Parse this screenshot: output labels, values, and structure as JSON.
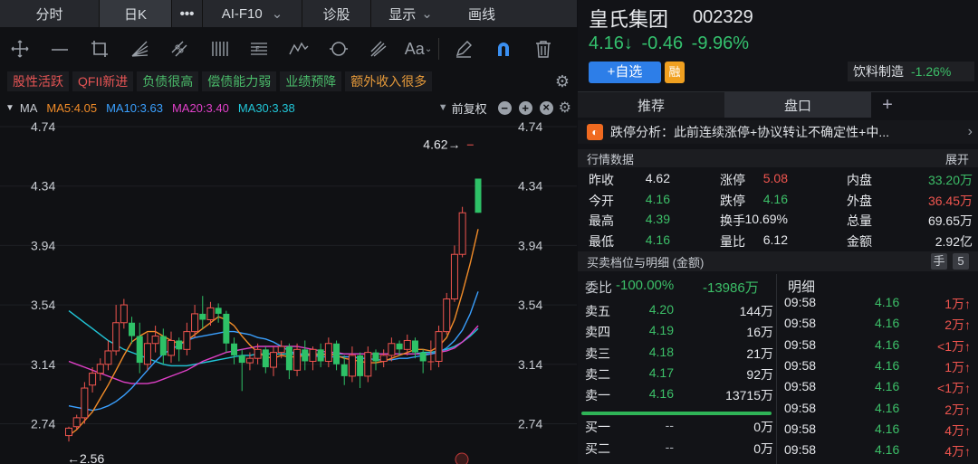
{
  "tabs": {
    "fenshi": "分时",
    "rik": "日K",
    "more": "•••",
    "aif10": "AI-F10",
    "zhengu": "诊股",
    "display": "显示",
    "draw": "画线"
  },
  "tags": [
    {
      "label": "股性活跃",
      "color": "red"
    },
    {
      "label": "QFII新进",
      "color": "red"
    },
    {
      "label": "负债很高",
      "color": "green"
    },
    {
      "label": "偿债能力弱",
      "color": "green"
    },
    {
      "label": "业绩预降",
      "color": "green"
    },
    {
      "label": "额外收入很多",
      "color": "orange"
    }
  ],
  "ma": {
    "label": "MA",
    "ma5": "MA5:4.05",
    "ma10": "MA10:3.63",
    "ma20": "MA20:3.40",
    "ma30": "MA30:3.38",
    "fq": "前复权",
    "colors": {
      "ma5": "#f28c28",
      "ma10": "#3aa0ff",
      "ma20": "#e040c8",
      "ma30": "#21c6d8"
    }
  },
  "chart_data": {
    "type": "candlestick",
    "ylim": [
      2.56,
      4.74
    ],
    "yticks": [
      "4.74",
      "4.34",
      "3.94",
      "3.54",
      "3.14",
      "2.74"
    ],
    "high_label": "4.62→",
    "low_label": "←2.56",
    "candles": [
      [
        2.66,
        2.71,
        2.62,
        2.72
      ],
      [
        2.72,
        2.78,
        2.7,
        2.8
      ],
      [
        2.78,
        2.98,
        2.74,
        3.02
      ],
      [
        3.0,
        3.08,
        2.95,
        3.12
      ],
      [
        3.08,
        3.14,
        3.03,
        3.18
      ],
      [
        3.14,
        3.23,
        3.1,
        3.3
      ],
      [
        3.23,
        3.42,
        3.2,
        3.54
      ],
      [
        3.42,
        3.54,
        3.38,
        3.58
      ],
      [
        3.42,
        3.33,
        3.28,
        3.46
      ],
      [
        3.33,
        3.15,
        3.08,
        3.42
      ],
      [
        3.14,
        3.28,
        3.1,
        3.35
      ],
      [
        3.28,
        3.33,
        3.22,
        3.4
      ],
      [
        3.33,
        3.2,
        3.14,
        3.38
      ],
      [
        3.2,
        3.3,
        3.15,
        3.36
      ],
      [
        3.3,
        3.24,
        3.16,
        3.32
      ],
      [
        3.24,
        3.36,
        3.2,
        3.42
      ],
      [
        3.36,
        3.48,
        3.32,
        3.54
      ],
      [
        3.48,
        3.44,
        3.38,
        3.6
      ],
      [
        3.44,
        3.52,
        3.4,
        3.56
      ],
      [
        3.52,
        3.48,
        3.42,
        3.55
      ],
      [
        3.48,
        3.28,
        3.22,
        3.5
      ],
      [
        3.28,
        3.2,
        3.14,
        3.32
      ],
      [
        3.2,
        3.15,
        2.96,
        3.24
      ],
      [
        3.15,
        3.18,
        3.1,
        3.22
      ],
      [
        3.18,
        3.24,
        3.14,
        3.28
      ],
      [
        3.24,
        3.12,
        3.08,
        3.26
      ],
      [
        3.12,
        3.22,
        3.06,
        3.26
      ],
      [
        3.22,
        3.26,
        3.18,
        3.3
      ],
      [
        3.26,
        3.1,
        3.04,
        3.28
      ],
      [
        3.1,
        3.24,
        3.06,
        3.28
      ],
      [
        3.24,
        3.16,
        3.1,
        3.3
      ],
      [
        3.16,
        3.24,
        3.1,
        3.26
      ],
      [
        3.24,
        3.16,
        3.12,
        3.28
      ],
      [
        3.16,
        3.28,
        3.12,
        3.32
      ],
      [
        3.28,
        3.14,
        3.1,
        3.3
      ],
      [
        3.14,
        3.06,
        3.0,
        3.2
      ],
      [
        3.06,
        3.2,
        3.02,
        3.26
      ],
      [
        3.2,
        3.06,
        2.98,
        3.22
      ],
      [
        3.06,
        3.22,
        3.02,
        3.26
      ],
      [
        3.22,
        3.16,
        3.1,
        3.24
      ],
      [
        3.16,
        3.2,
        3.12,
        3.24
      ],
      [
        3.2,
        3.28,
        3.16,
        3.32
      ],
      [
        3.28,
        3.24,
        3.2,
        3.3
      ],
      [
        3.24,
        3.3,
        3.2,
        3.34
      ],
      [
        3.3,
        3.22,
        3.18,
        3.32
      ],
      [
        3.22,
        3.16,
        3.08,
        3.24
      ],
      [
        3.16,
        3.16,
        3.1,
        3.3
      ],
      [
        3.16,
        3.36,
        3.12,
        3.4
      ],
      [
        3.36,
        3.58,
        3.34,
        3.62
      ],
      [
        3.58,
        3.88,
        3.56,
        3.94
      ],
      [
        3.88,
        4.16,
        3.86,
        4.2
      ],
      [
        4.62,
        4.62,
        4.62,
        4.62
      ],
      [
        4.39,
        4.16,
        4.16,
        4.39
      ]
    ],
    "ma5": [
      2.66,
      2.7,
      2.76,
      2.82,
      2.91,
      3.0,
      3.1,
      3.2,
      3.29,
      3.33,
      3.36,
      3.36,
      3.33,
      3.3,
      3.28,
      3.3,
      3.34,
      3.38,
      3.42,
      3.46,
      3.44,
      3.4,
      3.33,
      3.27,
      3.22,
      3.19,
      3.18,
      3.2,
      3.19,
      3.19,
      3.2,
      3.21,
      3.2,
      3.21,
      3.2,
      3.18,
      3.17,
      3.16,
      3.15,
      3.15,
      3.16,
      3.18,
      3.2,
      3.22,
      3.24,
      3.24,
      3.23,
      3.26,
      3.32,
      3.44,
      3.62,
      3.82,
      4.05
    ],
    "ma10": [
      2.86,
      2.85,
      2.84,
      2.83,
      2.84,
      2.86,
      2.89,
      2.93,
      2.98,
      3.04,
      3.1,
      3.16,
      3.21,
      3.24,
      3.27,
      3.3,
      3.32,
      3.33,
      3.34,
      3.35,
      3.36,
      3.36,
      3.35,
      3.34,
      3.32,
      3.31,
      3.29,
      3.26,
      3.23,
      3.21,
      3.2,
      3.2,
      3.19,
      3.19,
      3.19,
      3.19,
      3.19,
      3.18,
      3.18,
      3.17,
      3.17,
      3.17,
      3.18,
      3.18,
      3.19,
      3.2,
      3.21,
      3.22,
      3.25,
      3.3,
      3.37,
      3.48,
      3.63
    ],
    "ma20": [
      3.16,
      3.14,
      3.12,
      3.1,
      3.08,
      3.06,
      3.04,
      3.02,
      3.01,
      3.01,
      3.01,
      3.02,
      3.04,
      3.06,
      3.08,
      3.1,
      3.13,
      3.16,
      3.18,
      3.2,
      3.22,
      3.23,
      3.24,
      3.25,
      3.26,
      3.26,
      3.26,
      3.26,
      3.26,
      3.26,
      3.25,
      3.24,
      3.23,
      3.22,
      3.22,
      3.21,
      3.21,
      3.21,
      3.21,
      3.21,
      3.21,
      3.21,
      3.21,
      3.21,
      3.21,
      3.21,
      3.21,
      3.22,
      3.23,
      3.25,
      3.29,
      3.34,
      3.4
    ],
    "ma30": [
      3.5,
      3.46,
      3.42,
      3.38,
      3.34,
      3.3,
      3.27,
      3.24,
      3.22,
      3.2,
      3.18,
      3.16,
      3.14,
      3.13,
      3.13,
      3.13,
      3.14,
      3.15,
      3.16,
      3.17,
      3.18,
      3.19,
      3.2,
      3.2,
      3.21,
      3.21,
      3.21,
      3.21,
      3.21,
      3.21,
      3.21,
      3.21,
      3.21,
      3.21,
      3.21,
      3.21,
      3.21,
      3.21,
      3.21,
      3.21,
      3.21,
      3.21,
      3.21,
      3.21,
      3.21,
      3.22,
      3.22,
      3.23,
      3.24,
      3.26,
      3.29,
      3.33,
      3.38
    ]
  },
  "stock": {
    "name": "皇氏集团",
    "code": "002329",
    "price": "4.16↓",
    "change": "-0.46",
    "pct": "-9.96%",
    "add_btn": "+自选",
    "rong": "融",
    "sector": "饮料制造",
    "sector_pct": "-1.26%"
  },
  "rtabs": {
    "tuijian": "推荐",
    "pankou": "盘口",
    "plus": "+"
  },
  "analysis": {
    "text": "跌停分析：此前连续涨停+协议转让不确定性+中...",
    "arrow": "›"
  },
  "quote": {
    "header": "行情数据",
    "expand": "展开",
    "rows": [
      [
        {
          "l": "昨收",
          "v": "4.62",
          "c": "white"
        },
        {
          "l": "涨停",
          "v": "5.08",
          "c": "red"
        },
        {
          "l": "内盘",
          "v": "33.20万",
          "c": "green"
        }
      ],
      [
        {
          "l": "今开",
          "v": "4.16",
          "c": "green"
        },
        {
          "l": "跌停",
          "v": "4.16",
          "c": "green"
        },
        {
          "l": "外盘",
          "v": "36.45万",
          "c": "red"
        }
      ],
      [
        {
          "l": "最高",
          "v": "4.39",
          "c": "green"
        },
        {
          "l": "换手",
          "v": "10.69%",
          "c": "white"
        },
        {
          "l": "总量",
          "v": "69.65万",
          "c": "white"
        }
      ],
      [
        {
          "l": "最低",
          "v": "4.16",
          "c": "green"
        },
        {
          "l": "量比",
          "v": "6.12",
          "c": "white"
        },
        {
          "l": "金额",
          "v": "2.92亿",
          "c": "white"
        }
      ]
    ]
  },
  "ob": {
    "header": "买卖档位与明细 (金额)",
    "hand": "手",
    "five": "5",
    "weibi_label": "委比",
    "weibi_pct": "-100.00%",
    "weibi_val": "-13986万",
    "mingxi": "明细",
    "rows": [
      {
        "l": "卖五",
        "p": "4.20",
        "v": "144万",
        "pc": "green"
      },
      {
        "l": "卖四",
        "p": "4.19",
        "v": "16万",
        "pc": "green"
      },
      {
        "l": "卖三",
        "p": "4.18",
        "v": "21万",
        "pc": "green"
      },
      {
        "l": "卖二",
        "p": "4.17",
        "v": "92万",
        "pc": "green"
      },
      {
        "l": "卖一",
        "p": "4.16",
        "v": "13715万",
        "pc": "green"
      },
      {
        "l": "买一",
        "p": "--",
        "v": "0万",
        "pc": "gray"
      },
      {
        "l": "买二",
        "p": "--",
        "v": "0万",
        "pc": "gray"
      }
    ],
    "details": [
      {
        "t": "09:58",
        "p": "4.16",
        "v": "1万↑"
      },
      {
        "t": "09:58",
        "p": "4.16",
        "v": "2万↑"
      },
      {
        "t": "09:58",
        "p": "4.16",
        "v": "<1万↑"
      },
      {
        "t": "09:58",
        "p": "4.16",
        "v": "1万↑"
      },
      {
        "t": "09:58",
        "p": "4.16",
        "v": "<1万↑"
      },
      {
        "t": "09:58",
        "p": "4.16",
        "v": "2万↑"
      },
      {
        "t": "09:58",
        "p": "4.16",
        "v": "4万↑"
      },
      {
        "t": "09:58",
        "p": "4.16",
        "v": "4万↑"
      }
    ]
  }
}
